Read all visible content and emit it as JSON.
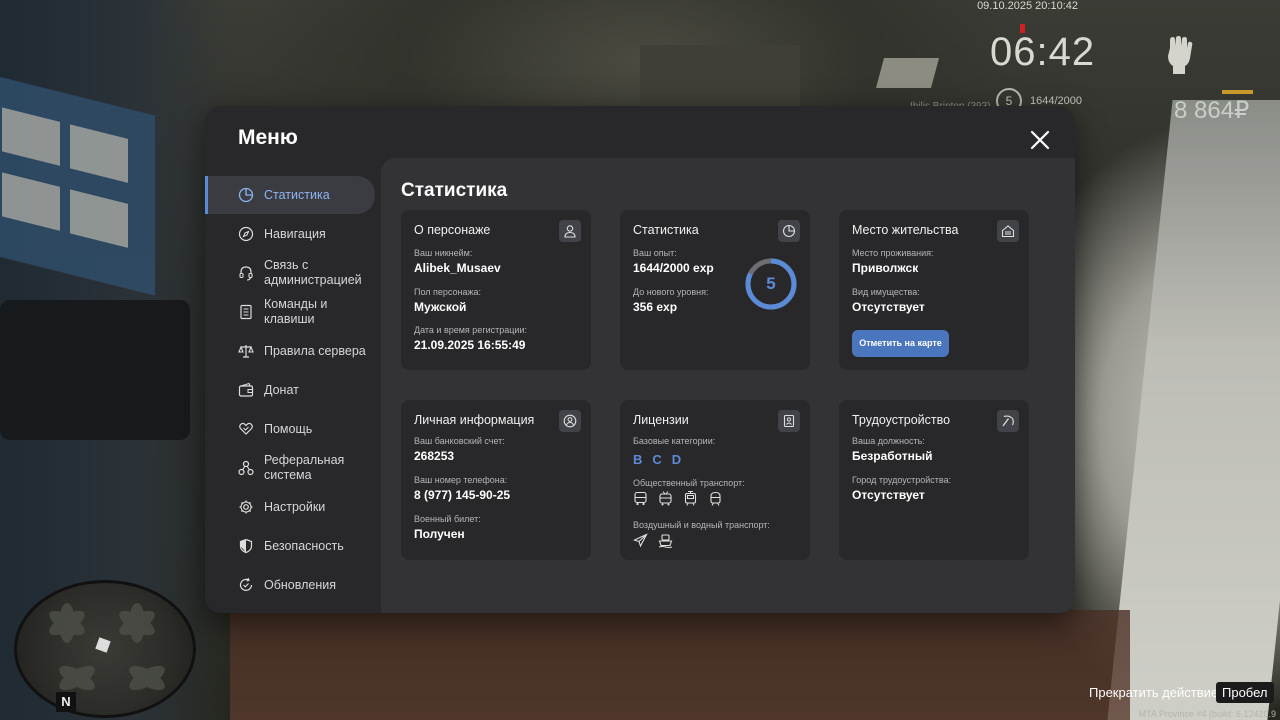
{
  "hud": {
    "datetime": "09.10.2025 20:10:42",
    "time": "06:42",
    "level": "5",
    "exp": "1644/2000",
    "player_name": "Ibilis Brinton (393)",
    "money": "8 864₽",
    "fist_icon": "fist-icon"
  },
  "hints": {
    "stop_action": "Прекратить действие",
    "key": "Пробел"
  },
  "build": "MTA Province #4 (build: 6.12420.9",
  "minimap": {
    "north": "N"
  },
  "menu": {
    "title": "Меню",
    "nav": [
      {
        "label": "Статистика",
        "icon": "pie-chart-icon",
        "active": true
      },
      {
        "label": "Навигация",
        "icon": "compass-icon"
      },
      {
        "label": "Связь с администрацией",
        "icon": "headset-icon"
      },
      {
        "label": "Команды и клавиши",
        "icon": "document-icon"
      },
      {
        "label": "Правила сервера",
        "icon": "scales-icon"
      },
      {
        "label": "Донат",
        "icon": "wallet-icon"
      },
      {
        "label": "Помощь",
        "icon": "heart-hands-icon"
      },
      {
        "label": "Реферальная система",
        "icon": "network-icon"
      },
      {
        "label": "Настройки",
        "icon": "gear-icon"
      },
      {
        "label": "Безопасность",
        "icon": "shield-icon"
      },
      {
        "label": "Обновления",
        "icon": "refresh-check-icon"
      }
    ]
  },
  "content": {
    "title": "Статистика",
    "character": {
      "title": "О персонаже",
      "nickname_label": "Ваш никнейм:",
      "nickname": "Alibek_Musaev",
      "gender_label": "Пол персонажа:",
      "gender": "Мужской",
      "reg_label": "Дата и время регистрации:",
      "reg": "21.09.2025 16:55:49"
    },
    "stats": {
      "title": "Статистика",
      "exp_label": "Ваш опыт:",
      "exp": "1644/2000 exp",
      "next_label": "До нового уровня:",
      "next": "356 exp",
      "level": "5",
      "progress": 0.822
    },
    "residence": {
      "title": "Место жительства",
      "place_label": "Место проживания:",
      "place": "Приволжск",
      "property_label": "Вид имущества:",
      "property": "Отсутствует",
      "button": "Отметить на карте"
    },
    "personal": {
      "title": "Личная информация",
      "bank_label": "Ваш банковский счет:",
      "bank": "268253",
      "phone_label": "Ваш номер телефона:",
      "phone": "8 (977) 145-90-25",
      "military_label": "Военный билет:",
      "military": "Получен"
    },
    "licenses": {
      "title": "Лицензии",
      "base_label": "Базовые категории:",
      "categories": [
        "B",
        "C",
        "D"
      ],
      "public_label": "Общественный транспорт:",
      "public_icons": [
        "bus-icon",
        "trolleybus-icon",
        "tram-icon",
        "metro-icon"
      ],
      "air_label": "Воздушный и водный транспорт:",
      "air_icons": [
        "plane-icon",
        "boat-icon"
      ]
    },
    "job": {
      "title": "Трудоустройство",
      "position_label": "Ваша должность:",
      "position": "Безработный",
      "city_label": "Город трудоустройства:",
      "city": "Отсутствует"
    }
  },
  "colors": {
    "accent": "#5b8ad6",
    "panel": "#28282a",
    "content": "#333335",
    "button": "#4a76be"
  }
}
